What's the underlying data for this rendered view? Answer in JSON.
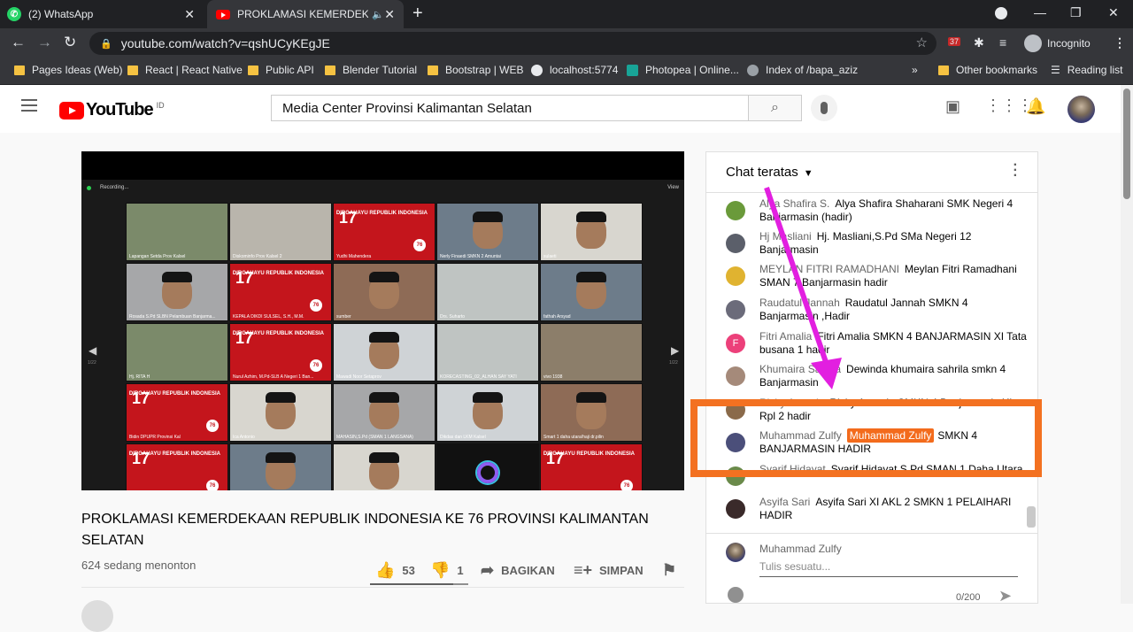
{
  "browser": {
    "tabs": [
      {
        "title": "(2) WhatsApp",
        "icon": "whatsapp-icon"
      },
      {
        "title": "PROKLAMASI KEMERDEKAAN",
        "icon": "youtube-icon"
      }
    ],
    "url": "youtube.com/watch?v=qshUCyKEgJE",
    "extension_badge": "37",
    "profile_label": "Incognito",
    "bookmarks": [
      "Pages Ideas (Web)",
      "React | React Native",
      "Public API",
      "Blender Tutorial",
      "Bootstrap | WEB",
      "localhost:5774",
      "Photopea | Online...",
      "Index of /bapa_aziz"
    ],
    "other_bookmarks": "Other bookmarks",
    "reading_list": "Reading list",
    "overflow": "»"
  },
  "youtube": {
    "logo": "YouTube",
    "country": "ID",
    "search_value": "Media Center Provinsi Kalimantan Selatan"
  },
  "video": {
    "status_left": "Recording...",
    "status_right": "View",
    "page_left": "1/22",
    "page_right": "1/22",
    "tiles": [
      {
        "name": "Lapangan Setda Prov Kalsel",
        "kind": "photo"
      },
      {
        "name": "Diskominfo Prov Kalsel 2",
        "kind": "photo"
      },
      {
        "name": "Yudhi Mahendera",
        "kind": "banner"
      },
      {
        "name": "Nerly Finaedi SMKN 2 Amuntai",
        "kind": "person"
      },
      {
        "name": "sulaeti",
        "kind": "person"
      },
      {
        "name": "Rosada S.Pd SLBN Pelambuan Banjarma...",
        "kind": "person"
      },
      {
        "name": "KEPALA DIKDI SULSEL, S.H., M.M.",
        "kind": "banner"
      },
      {
        "name": "sumber",
        "kind": "person"
      },
      {
        "name": "Drs. Suharto",
        "kind": "photo"
      },
      {
        "name": "fathah Arsyad",
        "kind": "person"
      },
      {
        "name": "Hj. RITA H",
        "kind": "photo"
      },
      {
        "name": "Nurul Azhim, M.Pd-SLB A Negeri 1 Ban...",
        "kind": "banner"
      },
      {
        "name": "Mawadi Noor Setaprov",
        "kind": "person"
      },
      {
        "name": "KORECASTING_02_ALHAN SAY YATI",
        "kind": "photo"
      },
      {
        "name": "vivo 1938",
        "kind": "photo"
      },
      {
        "name": "Bidin DPUPR Provinsi Kal",
        "kind": "banner"
      },
      {
        "name": "Ica Antonio",
        "kind": "person"
      },
      {
        "name": "MAHASIN,S.Pd (SMAN 1 LANGSANA)",
        "kind": "person"
      },
      {
        "name": "Dikdas dan LKM Kalsel",
        "kind": "person"
      },
      {
        "name": "Smart 1 daha utara/haji dr.pilin",
        "kind": "person"
      },
      {
        "name": "",
        "kind": "banner"
      },
      {
        "name": "",
        "kind": "person"
      },
      {
        "name": "",
        "kind": "person"
      },
      {
        "name": "",
        "kind": "camera"
      },
      {
        "name": "",
        "kind": "banner"
      }
    ],
    "banner_number": "17",
    "banner_text": "DIRGAHAYU REPUBLIK INDONESIA",
    "banner_badge": "76",
    "title": "PROKLAMASI KEMERDEKAAN REPUBLIK INDONESIA KE 76 PROVINSI KALIMANTAN SELATAN",
    "viewers": "624 sedang menonton",
    "likes": "53",
    "dislikes": "1",
    "like_ratio": 0.85,
    "share_label": "BAGIKAN",
    "save_label": "SIMPAN"
  },
  "chat": {
    "header": "Chat teratas",
    "messages": [
      {
        "author": "Alya Shafira S.",
        "text": "Alya Shafira Shaharani SMK Negeri 4 Banjarmasin (hadir)",
        "avatar_color": "#6a9a3a"
      },
      {
        "author": "Hj Masliani",
        "text": "Hj. Masliani,S.Pd SMa Negeri 12 Banjarmasin",
        "avatar_color": "#5b5f6a"
      },
      {
        "author": "MEYLAN FITRI RAMADHANI",
        "text": "Meylan Fitri Ramadhani SMAN 7 Banjarmasin hadir",
        "avatar_color": "#e0b330"
      },
      {
        "author": "Raudatul Jannah",
        "text": "Raudatul Jannah SMKN 4 Banjarmasin ,Hadir",
        "avatar_color": "#6b6b7a"
      },
      {
        "author": "Fitri Amalia",
        "text": "Fitri Amalia SMKN 4 BANJARMASIN XI Tata busana 1 hadir",
        "avatar_color": "#ec407a",
        "initial": "F"
      },
      {
        "author": "Khumaira Sahrila",
        "text": "Dewinda khumaira sahrila smkn 4 Banjarmasin",
        "avatar_color": "#a58a7a"
      },
      {
        "author": "Rizky Ananda",
        "text": "Rizky Ananda SMKN 4 Banjarmasin XI Rpl 2 hadir",
        "avatar_color": "#8a6a4a"
      },
      {
        "author": "Muhammad Zulfy",
        "badge": "Muhammad Zulfy",
        "text": "SMKN 4 BANJARMASIN HADIR",
        "avatar_color": "#4b4f7a"
      },
      {
        "author": "Syarif Hidayat",
        "text": "Syarif Hidayat S.Pd SMAN 1 Daha Utara",
        "avatar_color": "#6a8a4a"
      },
      {
        "author": "Asyifa Sari",
        "text": "Asyifa Sari XI AKL 2 SMKN 1 PELAIHARI HADIR",
        "avatar_color": "#3a2a2a"
      }
    ],
    "composer_name": "Muhammad Zulfy",
    "placeholder": "Tulis sesuatu...",
    "counter": "0/200"
  }
}
